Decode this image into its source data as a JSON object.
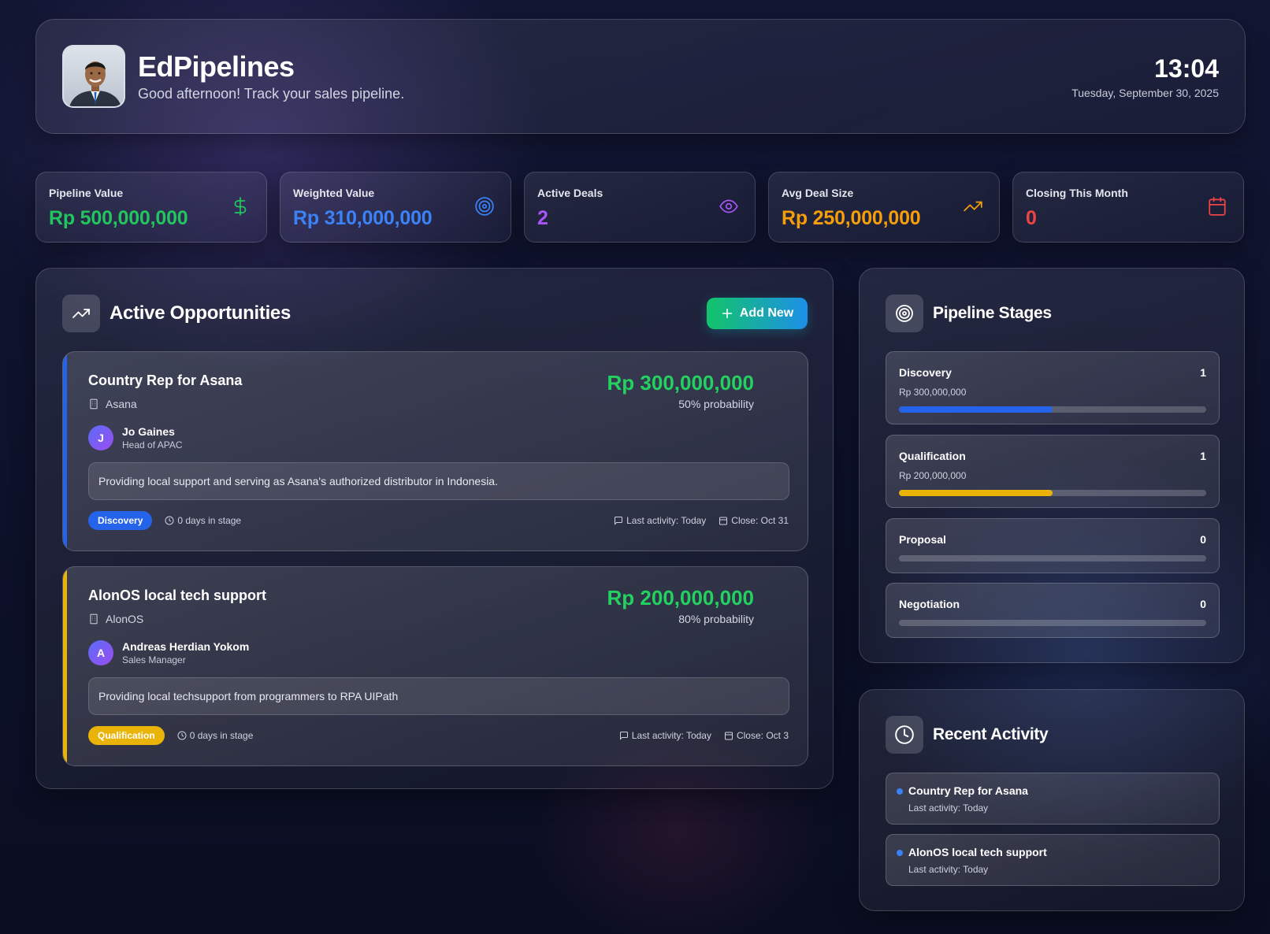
{
  "header": {
    "title": "EdPipelines",
    "subtitle": "Good afternoon! Track your sales pipeline.",
    "time": "13:04",
    "date": "Tuesday, September 30, 2025"
  },
  "stats": [
    {
      "label": "Pipeline Value",
      "value": "Rp 500,000,000",
      "color": "#22c55e",
      "icon": "dollar-icon"
    },
    {
      "label": "Weighted Value",
      "value": "Rp 310,000,000",
      "color": "#3b82f6",
      "icon": "target-icon"
    },
    {
      "label": "Active Deals",
      "value": "2",
      "color": "#a855f7",
      "icon": "eye-icon"
    },
    {
      "label": "Avg Deal Size",
      "value": "Rp 250,000,000",
      "color": "#f59e0b",
      "icon": "trending-up-icon"
    },
    {
      "label": "Closing This Month",
      "value": "0",
      "color": "#ef4444",
      "icon": "calendar-icon"
    }
  ],
  "opportunities": {
    "title": "Active Opportunities",
    "add_label": "Add New",
    "deals": [
      {
        "title": "Country Rep for Asana",
        "company": "Asana",
        "amount": "Rp 300,000,000",
        "probability": "50% probability",
        "contact_initial": "J",
        "contact_name": "Jo Gaines",
        "contact_role": "Head of APAC",
        "description": "Providing local support and serving as Asana's authorized distributor in Indonesia.",
        "stage": "Discovery",
        "stage_color": "#2563eb",
        "days": "0 days in stage",
        "last_activity": "Last activity: Today",
        "close": "Close: Oct 31"
      },
      {
        "title": "AlonOS local tech support",
        "company": "AlonOS",
        "amount": "Rp 200,000,000",
        "probability": "80% probability",
        "contact_initial": "A",
        "contact_name": "Andreas Herdian Yokom",
        "contact_role": "Sales Manager",
        "description": "Providing local techsupport from programmers to RPA UIPath",
        "stage": "Qualification",
        "stage_color": "#eab308",
        "days": "0 days in stage",
        "last_activity": "Last activity: Today",
        "close": "Close: Oct 3"
      }
    ]
  },
  "stages": {
    "title": "Pipeline Stages",
    "items": [
      {
        "name": "Discovery",
        "count": "1",
        "value": "Rp 300,000,000",
        "fill": 0.5,
        "color": "#2563eb"
      },
      {
        "name": "Qualification",
        "count": "1",
        "value": "Rp 200,000,000",
        "fill": 0.5,
        "color": "#eab308"
      },
      {
        "name": "Proposal",
        "count": "0",
        "value": "",
        "fill": 0,
        "color": "#22c55e"
      },
      {
        "name": "Negotiation",
        "count": "0",
        "value": "",
        "fill": 0,
        "color": "#a855f7"
      }
    ]
  },
  "activity": {
    "title": "Recent Activity",
    "items": [
      {
        "title": "Country Rep for Asana",
        "sub": "Last activity: Today"
      },
      {
        "title": "AlonOS local tech support",
        "sub": "Last activity: Today"
      }
    ]
  }
}
